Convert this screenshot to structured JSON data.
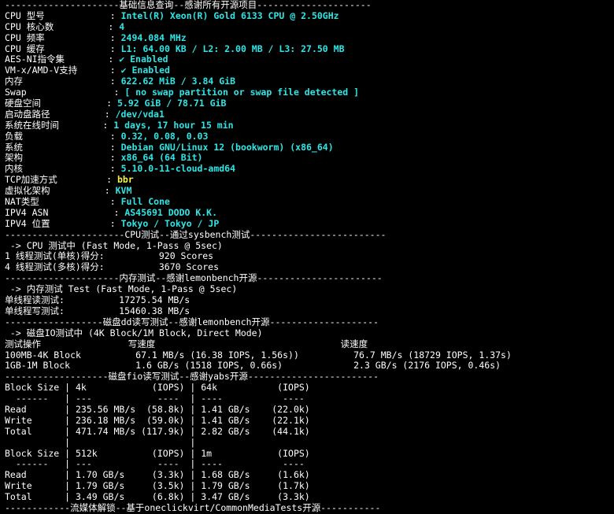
{
  "terminal": {
    "lines": [
      {
        "kind": "sep",
        "text": "---------------------基础信息查询--感谢所有开源项目---------------------"
      },
      {
        "kind": "kv",
        "label": "CPU 型号            : ",
        "value": "Intel(R) Xeon(R) Gold 6133 CPU @ 2.50GHz",
        "color": "cyan"
      },
      {
        "kind": "kv",
        "label": "CPU 核心数          : ",
        "value": "4",
        "color": "cyan"
      },
      {
        "kind": "kv",
        "label": "CPU 频率            : ",
        "value": "2494.084 MHz",
        "color": "cyan"
      },
      {
        "kind": "kv",
        "label": "CPU 缓存            : ",
        "value": "L1: 64.00 KB / L2: 2.00 MB / L3: 27.50 MB",
        "color": "cyan"
      },
      {
        "kind": "kv",
        "label": "AES-NI指令集        : ",
        "value": "✔ Enabled",
        "color": "cyan"
      },
      {
        "kind": "kv",
        "label": "VM-x/AMD-V支持      : ",
        "value": "✔ Enabled",
        "color": "cyan"
      },
      {
        "kind": "kv",
        "label": "内存                : ",
        "value": "622.62 MiB / 3.84 GiB",
        "color": "cyan"
      },
      {
        "kind": "kv",
        "label": "Swap                : ",
        "value": "[ no swap partition or swap file detected ]",
        "color": "cyan"
      },
      {
        "kind": "kv",
        "label": "硬盘空间            : ",
        "value": "5.92 GiB / 78.71 GiB",
        "color": "cyan"
      },
      {
        "kind": "kv",
        "label": "启动盘路径          : ",
        "value": "/dev/vda1",
        "color": "cyan"
      },
      {
        "kind": "kv",
        "label": "系统在线时间        : ",
        "value": "1 days, 17 hour 15 min",
        "color": "cyan"
      },
      {
        "kind": "kv",
        "label": "负载                : ",
        "value": "0.32, 0.08, 0.03",
        "color": "cyan"
      },
      {
        "kind": "kv",
        "label": "系统                : ",
        "value": "Debian GNU/Linux 12 (bookworm) (x86_64)",
        "color": "cyan"
      },
      {
        "kind": "kv",
        "label": "架构                : ",
        "value": "x86_64 (64 Bit)",
        "color": "cyan"
      },
      {
        "kind": "kv",
        "label": "内核                : ",
        "value": "5.10.0-11-cloud-amd64",
        "color": "cyan"
      },
      {
        "kind": "kv",
        "label": "TCP加速方式         : ",
        "value": "bbr",
        "color": "yellow"
      },
      {
        "kind": "kv",
        "label": "虚拟化架构          : ",
        "value": "KVM",
        "color": "cyan"
      },
      {
        "kind": "kv",
        "label": "NAT类型             : ",
        "value": "Full Cone",
        "color": "cyan"
      },
      {
        "kind": "kv",
        "label": "IPV4 ASN            : ",
        "value": "AS45691 DODO K.K.",
        "color": "cyan"
      },
      {
        "kind": "kv",
        "label": "IPV4 位置           : ",
        "value": "Tokyo / Tokyo / JP",
        "color": "cyan"
      },
      {
        "kind": "sep",
        "text": "----------------------CPU测试--通过sysbench测试-------------------------"
      },
      {
        "kind": "plain",
        "text": " -> CPU 测试中 (Fast Mode, 1-Pass @ 5sec)"
      },
      {
        "kind": "plain",
        "text": "1 线程测试(单核)得分:          920 Scores"
      },
      {
        "kind": "plain",
        "text": "4 线程测试(多核)得分:          3670 Scores"
      },
      {
        "kind": "sep",
        "text": "---------------------内存测试--感谢lemonbench开源-----------------------"
      },
      {
        "kind": "plain",
        "text": " -> 内存测试 Test (Fast Mode, 1-Pass @ 5sec)"
      },
      {
        "kind": "plain",
        "text": "单线程读测试:          17275.54 MB/s"
      },
      {
        "kind": "plain",
        "text": "单线程写测试:          15460.38 MB/s"
      },
      {
        "kind": "sep",
        "text": "------------------磁盘dd读写测试--感谢lemonbench开源--------------------"
      },
      {
        "kind": "plain",
        "text": " -> 磁盘IO测试中 (4K Block/1M Block, Direct Mode)"
      },
      {
        "kind": "plain",
        "text": "测试操作                写速度                                  读速度"
      },
      {
        "kind": "plain",
        "text": "100MB-4K Block          67.1 MB/s (16.38 IOPS, 1.56s))          76.7 MB/s (18729 IOPS, 1.37s)"
      },
      {
        "kind": "plain",
        "text": "1GB-1M Block            1.6 GB/s (1518 IOPS, 0.66s)             2.3 GB/s (2176 IOPS, 0.46s)"
      },
      {
        "kind": "sep",
        "text": "-------------------磁盘fio读写测试--感谢yabs开源------------------------"
      },
      {
        "kind": "plain",
        "text": "Block Size | 4k            (IOPS) | 64k           (IOPS)"
      },
      {
        "kind": "plain",
        "text": "  ------   | ---            ----  | ----           ---- "
      },
      {
        "kind": "plain",
        "text": "Read       | 235.56 MB/s  (58.8k) | 1.41 GB/s    (22.0k)"
      },
      {
        "kind": "plain",
        "text": "Write      | 236.18 MB/s  (59.0k) | 1.41 GB/s    (22.1k)"
      },
      {
        "kind": "plain",
        "text": "Total      | 471.74 MB/s (117.9k) | 2.82 GB/s    (44.1k)"
      },
      {
        "kind": "plain",
        "text": "           |                      |                     "
      },
      {
        "kind": "plain",
        "text": "Block Size | 512k          (IOPS) | 1m            (IOPS)"
      },
      {
        "kind": "plain",
        "text": "  ------   | ---            ----  | ----           ---- "
      },
      {
        "kind": "plain",
        "text": "Read       | 1.70 GB/s     (3.3k) | 1.68 GB/s     (1.6k)"
      },
      {
        "kind": "plain",
        "text": "Write      | 1.79 GB/s     (3.5k) | 1.79 GB/s     (1.7k)"
      },
      {
        "kind": "plain",
        "text": "Total      | 3.49 GB/s     (6.8k) | 3.47 GB/s     (3.3k)"
      },
      {
        "kind": "sep",
        "text": "------------流媒体解锁--基于oneclickvirt/CommonMediaTests开源-----------"
      }
    ]
  },
  "colors": {
    "background": "#000000",
    "text": "#ffffff",
    "value": "#2ee6e6",
    "highlight": "#f2f24a"
  }
}
